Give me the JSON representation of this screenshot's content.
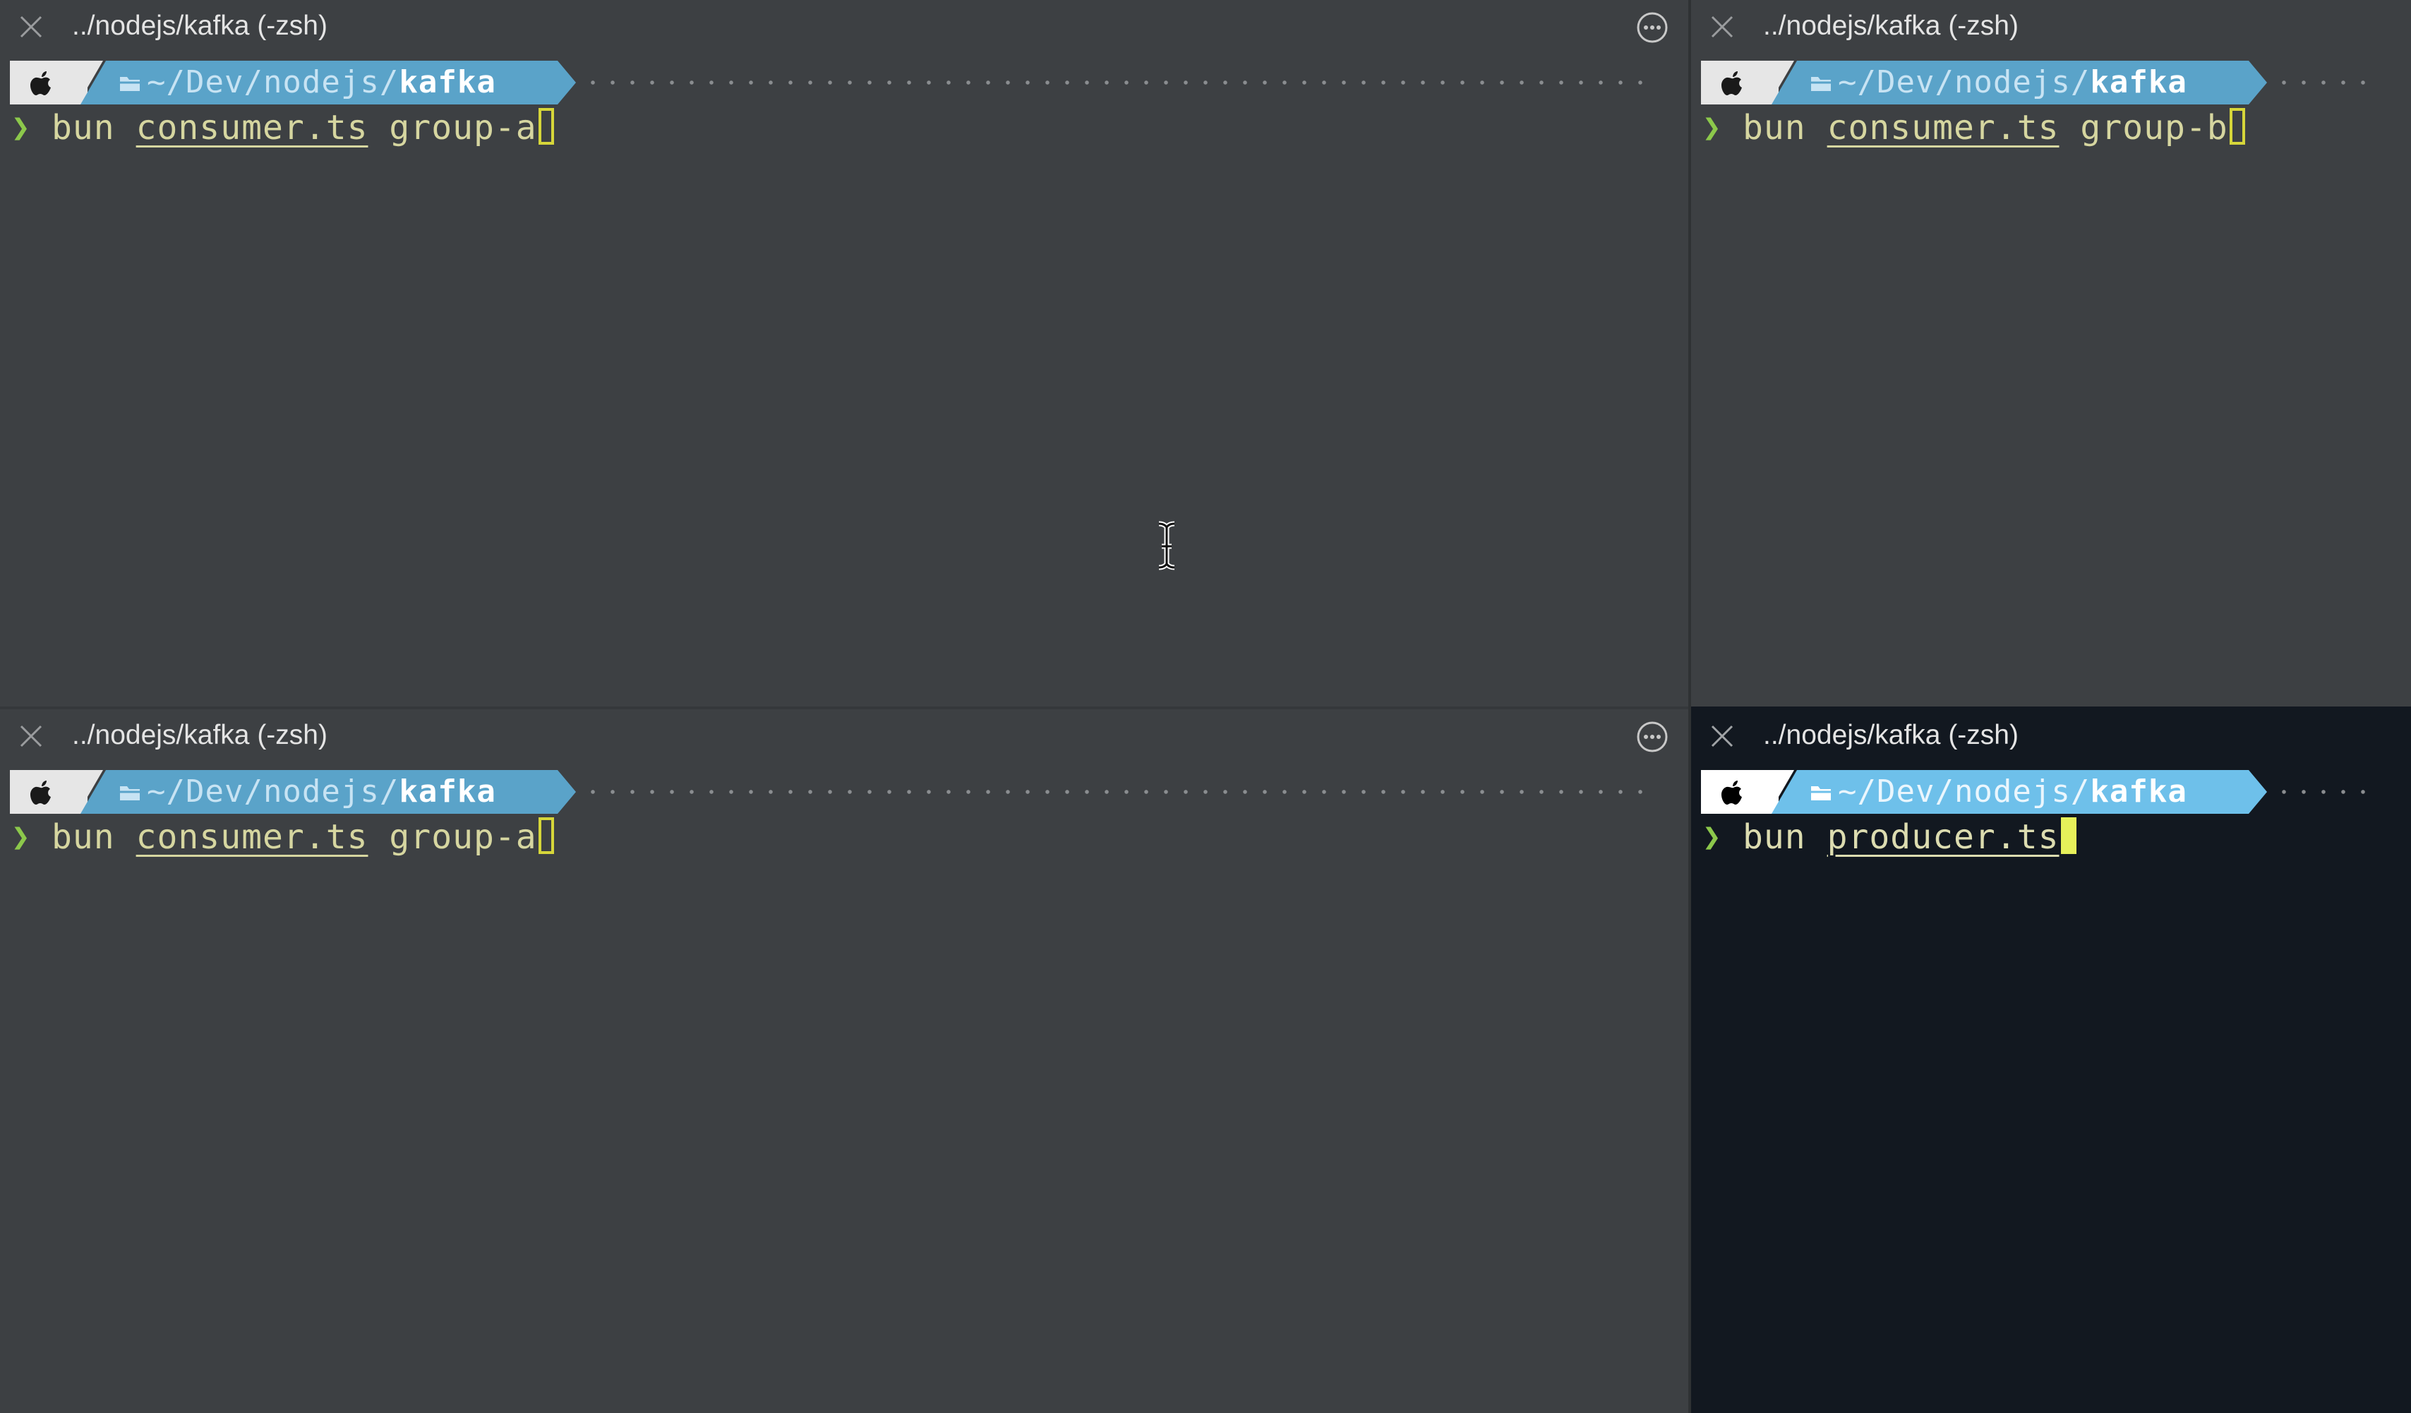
{
  "panes": [
    {
      "id": "top-left",
      "title": "../nodejs/kafka (-zsh)",
      "path_prefix": "~/Dev/nodejs/",
      "path_dir": "kafka",
      "cmd": "bun",
      "file": "consumer.ts",
      "arg": "group-a",
      "active": false
    },
    {
      "id": "top-right",
      "title": "../nodejs/kafka (-zsh)",
      "path_prefix": "~/Dev/nodejs/",
      "path_dir": "kafka",
      "cmd": "bun",
      "file": "consumer.ts",
      "arg": "group-b",
      "active": false
    },
    {
      "id": "bottom-left",
      "title": "../nodejs/kafka (-zsh)",
      "path_prefix": "~/Dev/nodejs/",
      "path_dir": "kafka",
      "cmd": "bun",
      "file": "consumer.ts",
      "arg": "group-a",
      "active": false
    },
    {
      "id": "bottom-right",
      "title": "../nodejs/kafka (-zsh)",
      "path_prefix": "~/Dev/nodejs/",
      "path_dir": "kafka",
      "cmd": "bun",
      "file": "producer.ts",
      "arg": "",
      "active": true
    }
  ],
  "icons": {
    "close": "close-icon",
    "more": "more-icon",
    "apple": "apple-icon",
    "folder": "folder-icon",
    "prompt": "chevron-right-icon",
    "pointer": "text-ibeam-cursor-icon"
  },
  "colors": {
    "pane_bg": "#3d4043",
    "active_pane_bg": "#121820",
    "path_segment": "#5aa3c9",
    "prompt_chevron": "#8cc84b",
    "cursor": "#d6d63a"
  }
}
